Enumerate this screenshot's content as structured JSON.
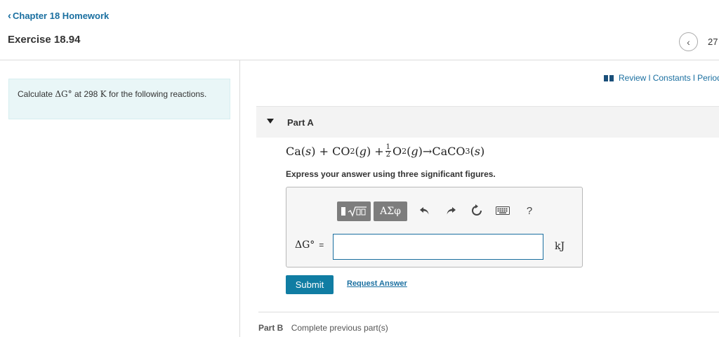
{
  "header": {
    "back_label": "Chapter 18 Homework",
    "exercise_title": "Exercise 18.94",
    "nav_count": "27"
  },
  "question": {
    "prefix": "Calculate ",
    "delta_g": "ΔG°",
    "middle": " at 298 ",
    "kelvin": "K",
    "suffix": " for the following reactions."
  },
  "review": {
    "review_label": "Review",
    "separator": "I",
    "constants_label": "Constants",
    "periodic_label": "Periodic Table"
  },
  "part_a": {
    "title": "Part A",
    "equation": {
      "t1": "Ca(",
      "s1": "s",
      "t2": ") + CO",
      "sub2a": "2",
      "t3": "(",
      "g1": "g",
      "t4": ") + ",
      "frac_num": "1",
      "frac_den": "2",
      "t5": "O",
      "sub2b": "2",
      "t6": "(",
      "g2": "g",
      "t7": ")→CaCO",
      "sub3": "3",
      "t8": "(",
      "s2": "s",
      "t9": ")"
    },
    "instruction": "Express your answer using three significant figures.",
    "toolbar": {
      "greek_label": "ΑΣφ",
      "help_label": "?"
    },
    "answer_label": "ΔG°",
    "equals": "=",
    "input_value": "",
    "unit": "kJ",
    "submit_label": "Submit",
    "request_label": "Request Answer"
  },
  "part_b": {
    "label": "Part B",
    "status": "Complete previous part(s)"
  }
}
